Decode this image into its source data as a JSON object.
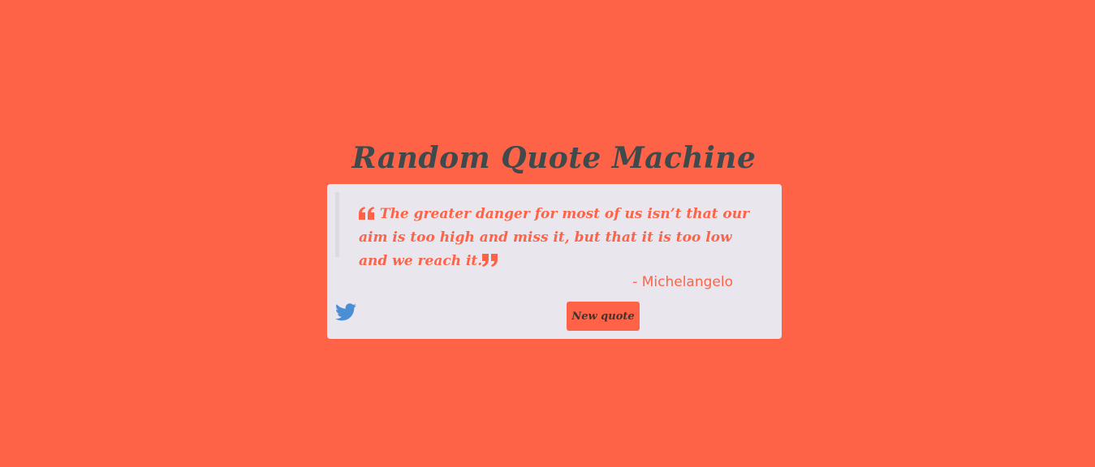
{
  "header": {
    "title": "Random Quote Machine"
  },
  "quote": {
    "text": "The greater danger for most of us isn’t that our aim is too high and miss it, but that it is too low and we reach it.",
    "author": "- Michelangelo"
  },
  "actions": {
    "new_quote_label": "New quote",
    "tweet_icon": "twitter-icon"
  },
  "colors": {
    "background": "#ff6347",
    "card": "#eae6ee",
    "title": "#3f4a4c",
    "accent": "#ff6347",
    "twitter": "#4a8ed6"
  }
}
